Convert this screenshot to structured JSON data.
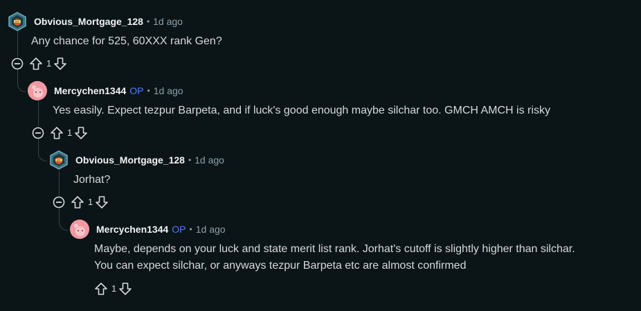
{
  "comments": [
    {
      "username": "Obvious_Mortgage_128",
      "is_op": false,
      "op_label": "",
      "separator": "•",
      "time": "1d ago",
      "lines": [
        "Any chance for 525, 60XXX rank Gen?"
      ],
      "score": "1",
      "avatar": "hex-avatar"
    },
    {
      "username": "Mercychen1344",
      "is_op": true,
      "op_label": "OP",
      "separator": "•",
      "time": "1d ago",
      "lines": [
        "Yes easily. Expect tezpur Barpeta, and if luck's good enough maybe silchar too. GMCH AMCH is risky"
      ],
      "score": "1",
      "avatar": "pink-avatar"
    },
    {
      "username": "Obvious_Mortgage_128",
      "is_op": false,
      "op_label": "",
      "separator": "•",
      "time": "1d ago",
      "lines": [
        "Jorhat?"
      ],
      "score": "1",
      "avatar": "hex-avatar"
    },
    {
      "username": "Mercychen1344",
      "is_op": true,
      "op_label": "OP",
      "separator": "•",
      "time": "1d ago",
      "lines": [
        "Maybe, depends on your luck and state merit list rank. Jorhat's cutoff is slightly higher than silchar.",
        "You can expect silchar, or anyways tezpur Barpeta etc are almost confirmed"
      ],
      "score": "1",
      "avatar": "pink-avatar"
    }
  ],
  "colors": {
    "background": "#0b1416",
    "text": "#d7dadc",
    "meta": "#8ba2ad",
    "op": "#4a7dff",
    "thread_line": "#33464c"
  }
}
